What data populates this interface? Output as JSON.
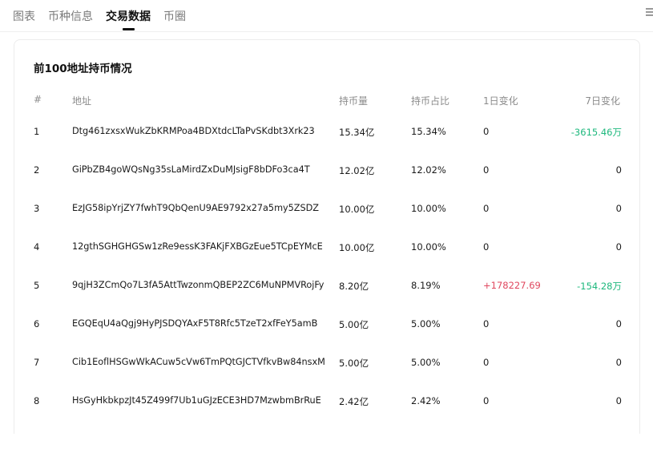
{
  "tabs": [
    {
      "label": "图表"
    },
    {
      "label": "币种信息"
    },
    {
      "label": "交易数据"
    },
    {
      "label": "币圈"
    }
  ],
  "card": {
    "title": "前100地址持币情况",
    "columns": {
      "index": "#",
      "address": "地址",
      "amount": "持币量",
      "share": "持币占比",
      "change_1d": "1日变化",
      "change_7d": "7日变化"
    },
    "rows": [
      {
        "idx": "1",
        "address": "Dtg461zxsxWukZbKRMPoa4BDXtdcLTaPvSKdbt3Xrk23",
        "amount": "15.34亿",
        "share": "15.34%",
        "d1": "0",
        "d7": "-3615.46万"
      },
      {
        "idx": "2",
        "address": "GiPbZB4goWQsNg35sLaMirdZxDuMJsigF8bDFo3ca4T",
        "amount": "12.02亿",
        "share": "12.02%",
        "d1": "0",
        "d7": "0"
      },
      {
        "idx": "3",
        "address": "EzJG58ipYrjZY7fwhT9QbQenU9AE9792x27a5my5ZSDZ",
        "amount": "10.00亿",
        "share": "10.00%",
        "d1": "0",
        "d7": "0"
      },
      {
        "idx": "4",
        "address": "12gthSGHGHGSw1zRe9essK3FAKjFXBGzEue5TCpEYMcE",
        "amount": "10.00亿",
        "share": "10.00%",
        "d1": "0",
        "d7": "0"
      },
      {
        "idx": "5",
        "address": "9qjH3ZCmQo7L3fA5AttTwzonmQBEP2ZC6MuNPMVRojFy",
        "amount": "8.20亿",
        "share": "8.19%",
        "d1": "+178227.69",
        "d7": "-154.28万"
      },
      {
        "idx": "6",
        "address": "EGQEqU4aQgj9HyPJSDQYAxF5T8Rfc5TzeT2xfFeY5amB",
        "amount": "5.00亿",
        "share": "5.00%",
        "d1": "0",
        "d7": "0"
      },
      {
        "idx": "7",
        "address": "Cib1EoflHSGwWkACuw5cVw6TmPQtGJCTVfkvBw84nsxM",
        "amount": "5.00亿",
        "share": "5.00%",
        "d1": "0",
        "d7": "0"
      },
      {
        "idx": "8",
        "address": "HsGyHkbkpzJt45Z499f7Ub1uGJzECE3HD7MzwbmBrRuE",
        "amount": "2.42亿",
        "share": "2.42%",
        "d1": "0",
        "d7": "0"
      }
    ]
  },
  "colors": {
    "positive": "#e0485f",
    "negative": "#1eb87d",
    "text": "#1a1a1a",
    "muted": "#8c8c8c"
  },
  "icons": {
    "menu": "hamburger-icon"
  }
}
